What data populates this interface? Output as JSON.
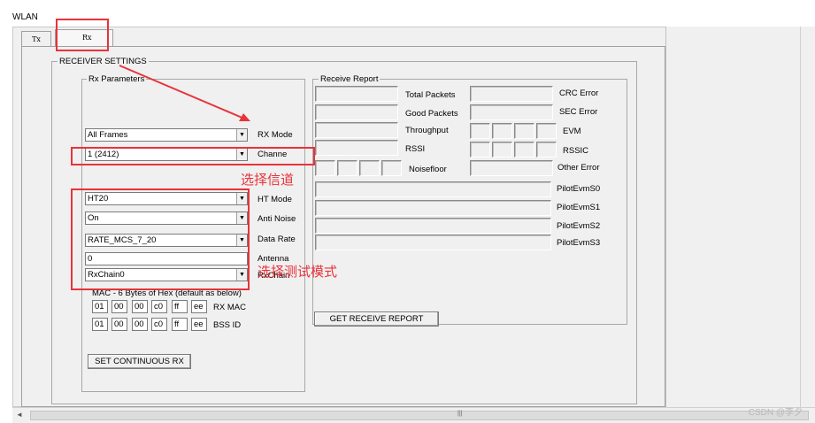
{
  "window": {
    "title": "WLAN"
  },
  "tabs": [
    {
      "label": "Tx"
    },
    {
      "label": "Rx"
    }
  ],
  "receiver_settings": {
    "group_label": "RECEIVER SETTINGS",
    "rx_parameters": {
      "group_label": "Rx Parameters",
      "rx_mode": {
        "value": "All Frames",
        "label": "RX Mode"
      },
      "channel": {
        "value": "1 (2412)",
        "label": "Channe"
      },
      "ht_mode": {
        "value": "HT20",
        "label": "HT Mode"
      },
      "anti_noise": {
        "value": "On",
        "label": "Anti Noise"
      },
      "data_rate": {
        "value": "RATE_MCS_7_20",
        "label": "Data Rate"
      },
      "antenna": {
        "value": "0",
        "label": "Antenna"
      },
      "rx_chain": {
        "value": "RxChain0",
        "label": "RxChain"
      },
      "mac_caption": "MAC - 6 Bytes of Hex (default as below)",
      "rx_mac": {
        "label": "RX MAC",
        "bytes": [
          "01",
          "00",
          "00",
          "c0",
          "ff",
          "ee"
        ]
      },
      "bss_id": {
        "label": "BSS ID",
        "bytes": [
          "01",
          "00",
          "00",
          "c0",
          "ff",
          "ee"
        ]
      },
      "set_button": "SET CONTINUOUS RX"
    },
    "receive_report": {
      "group_label": "Receive Report",
      "total_packets": "Total Packets",
      "good_packets": "Good Packets",
      "throughput": "Throughput",
      "rssi": "RSSI",
      "noisefloor": "Noisefloor",
      "crc_error": "CRC Error",
      "sec_error": "SEC Error",
      "evm": "EVM",
      "rssic": "RSSIC",
      "other_error": "Other Error",
      "pilot_labels": [
        "PilotEvmS0",
        "PilotEvmS1",
        "PilotEvmS2",
        "PilotEvmS3"
      ],
      "get_button": "GET RECEIVE REPORT"
    }
  },
  "annotations": {
    "select_channel": "选择信道",
    "select_test_mode": "选择测试模式",
    "color": "#e8333b"
  },
  "watermark": "CSDN @李夕"
}
